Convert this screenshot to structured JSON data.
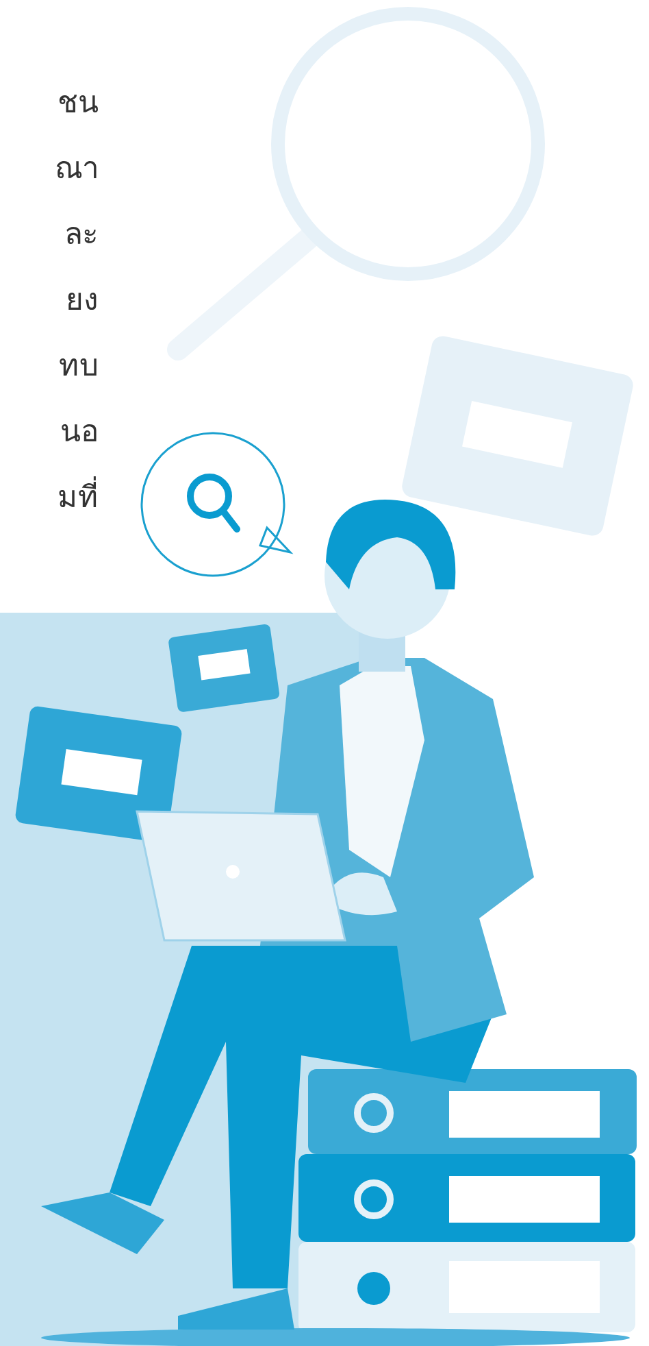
{
  "text_lines": [
    "ชน",
    "ณา",
    "ละ",
    "ยง",
    "ทบ",
    "นอ",
    "มที่"
  ]
}
